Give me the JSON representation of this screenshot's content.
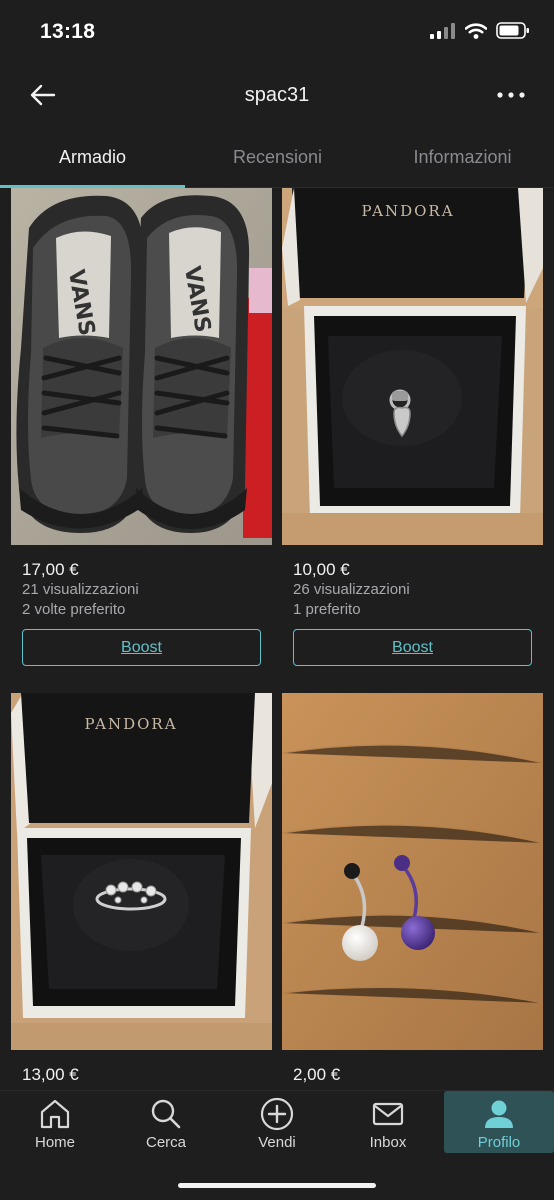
{
  "status_bar": {
    "time": "13:18"
  },
  "header": {
    "title": "spac31"
  },
  "tabs": [
    {
      "label": "Armadio",
      "active": true
    },
    {
      "label": "Recensioni",
      "active": false
    },
    {
      "label": "Informazioni",
      "active": false
    }
  ],
  "items": [
    {
      "photo_icon": "black-vans-sneakers",
      "price": "17,00 €",
      "views": "21 visualizzazioni",
      "favorites": "2 volte preferito",
      "boost_label": "Boost"
    },
    {
      "photo_icon": "pandora-heart-charm-box",
      "brand_text": "PANDORA",
      "price": "10,00 €",
      "views": "26 visualizzazioni",
      "favorites": "1 preferito",
      "boost_label": "Boost"
    },
    {
      "photo_icon": "pandora-ring-box",
      "brand_text": "PANDORA",
      "price": "13,00 €"
    },
    {
      "photo_icon": "belly-piercings",
      "price": "2,00 €"
    }
  ],
  "bottom_nav": [
    {
      "label": "Home",
      "icon": "home-icon",
      "active": false
    },
    {
      "label": "Cerca",
      "icon": "search-icon",
      "active": false
    },
    {
      "label": "Vendi",
      "icon": "plus-circle-icon",
      "active": false
    },
    {
      "label": "Inbox",
      "icon": "mail-icon",
      "active": false
    },
    {
      "label": "Profilo",
      "icon": "profile-icon",
      "active": true
    }
  ],
  "colors": {
    "accent": "#5fc2c8",
    "background": "#1e1e1f",
    "active_nav_bg": "#2f5257"
  }
}
